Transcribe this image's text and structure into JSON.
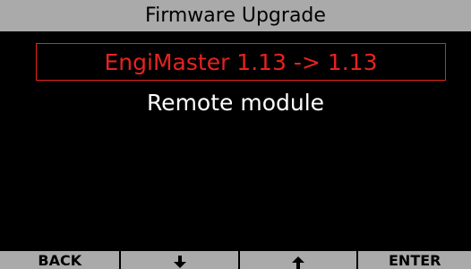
{
  "header": {
    "title": "Firmware Upgrade"
  },
  "menu": {
    "items": [
      {
        "label": "EngiMaster 1.13 -> 1.13",
        "selected": true
      },
      {
        "label": "Remote module",
        "selected": false
      }
    ]
  },
  "softkeys": {
    "back_label": "BACK",
    "down_icon": "arrow-down-icon",
    "up_icon": "arrow-up-icon",
    "enter_label": "ENTER"
  },
  "colors": {
    "title_bar": "#aaaaaa",
    "selected_text": "#e6231e",
    "normal_text": "#ffffff",
    "background": "#000000"
  }
}
